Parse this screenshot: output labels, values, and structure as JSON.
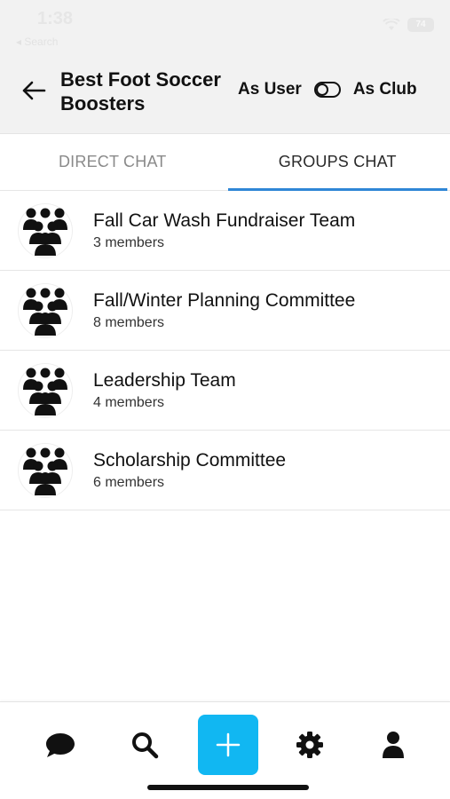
{
  "status_bar": {
    "time": "1:38",
    "sub_label": "◂ Search",
    "battery": "74"
  },
  "header": {
    "title": "Best Foot Soccer Boosters",
    "mode_user_label": "As User",
    "mode_club_label": "As Club"
  },
  "tabs": [
    {
      "label": "DIRECT CHAT",
      "active": false
    },
    {
      "label": "GROUPS CHAT",
      "active": true
    }
  ],
  "groups": [
    {
      "name": "Fall Car Wash Fundraiser Team",
      "members": "3 members"
    },
    {
      "name": "Fall/Winter Planning Committee",
      "members": "8 members"
    },
    {
      "name": "Leadership Team",
      "members": "4 members"
    },
    {
      "name": "Scholarship Committee",
      "members": "6 members"
    }
  ],
  "bottom_nav": {
    "items": [
      "chat-icon",
      "search-icon",
      "add-icon",
      "settings-icon",
      "profile-icon"
    ]
  },
  "colors": {
    "accent": "#11b7f2",
    "tab_indicator": "#2f86d6"
  }
}
